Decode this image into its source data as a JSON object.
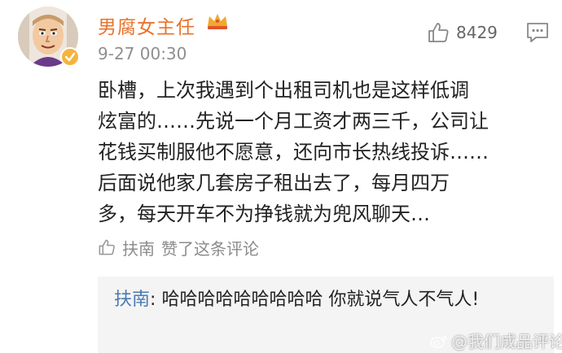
{
  "post": {
    "author": "男腐女主任",
    "timestamp": "9-27 00:30",
    "like_count": "8429",
    "lines": [
      "卧槽，上次我遇到个出租司机也是这样低调",
      "炫富的……先说一个月工资才两三千，公司让",
      "花钱买制服他不愿意，还向市长热线投诉……",
      "后面说他家几套房子租出去了，每月四万",
      "多，每天开车不为挣钱就为兜风聊天…"
    ]
  },
  "liked_by": {
    "user": "扶南",
    "text": "赞了这条评论"
  },
  "reply": {
    "user": "扶南",
    "separator": ":",
    "text": "哈哈哈哈哈哈哈哈哈 你就说气人不气人!"
  },
  "watermark": {
    "text": "@我们成品评论"
  },
  "colors": {
    "username": "#e9722b",
    "reply_user": "#4a7ab5",
    "meta": "#8f8f8f",
    "reply_bg": "#f4f4f4",
    "verified_badge": "#f5b33b"
  },
  "icons": [
    "avatar",
    "verified-badge-icon",
    "crown-icon",
    "thumbs-up-icon",
    "comment-icon",
    "liked-thumb-icon",
    "weibo-icon"
  ]
}
